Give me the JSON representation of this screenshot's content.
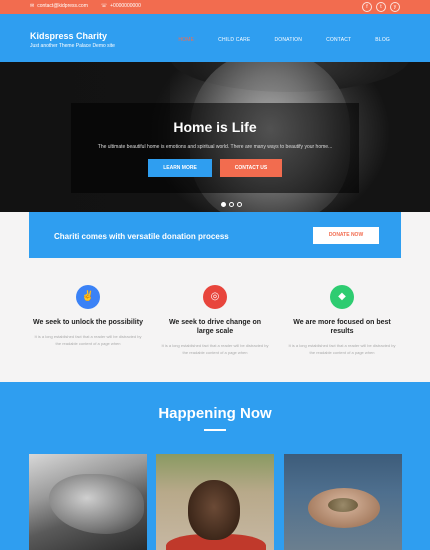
{
  "topbar": {
    "email": "contact@kidpress.com",
    "phone": "+0000000000",
    "social": [
      {
        "icon": "facebook-icon",
        "glyph": "f"
      },
      {
        "icon": "twitter-icon",
        "glyph": "t"
      },
      {
        "icon": "twitter-bird-icon",
        "glyph": "y"
      }
    ]
  },
  "header": {
    "title": "Kidspress Charity",
    "tagline": "Just another Theme Palace Demo site",
    "nav": [
      "HOME",
      "CHILD CARE",
      "DONATION",
      "CONTACT",
      "BLOG"
    ],
    "active_nav": "HOME"
  },
  "hero": {
    "title": "Home is Life",
    "subtitle": "The ultimate beautiful home is emotions and spiritual world. There are many ways to beautify your home...",
    "primary_button": "LEARN MORE",
    "secondary_button": "CONTACT US",
    "slides": 3,
    "active_slide": 1
  },
  "donate": {
    "text": "Chariti comes with versatile donation process",
    "button": "DONATE NOW"
  },
  "features": [
    {
      "icon": "peace-icon",
      "glyph": "✌",
      "color": "#3b82f6",
      "title": "We seek to unlock the possibility",
      "desc": "It is a long established fact that a reader will be distracted by the readable content of a page when"
    },
    {
      "icon": "target-icon",
      "glyph": "◎",
      "color": "#e8453c",
      "title": "We seek to drive change on large scale",
      "desc": "It is a long established fact that a reader will be distracted by the readable content of a page when"
    },
    {
      "icon": "diamond-icon",
      "glyph": "◆",
      "color": "#2ecc71",
      "title": "We are more focused on best results",
      "desc": "It is a long established fact that a reader will be distracted by the readable content of a page when"
    }
  ],
  "happening": {
    "title": "Happening Now"
  },
  "colors": {
    "accent": "#f26c4f",
    "brand": "#2f9ef0"
  }
}
